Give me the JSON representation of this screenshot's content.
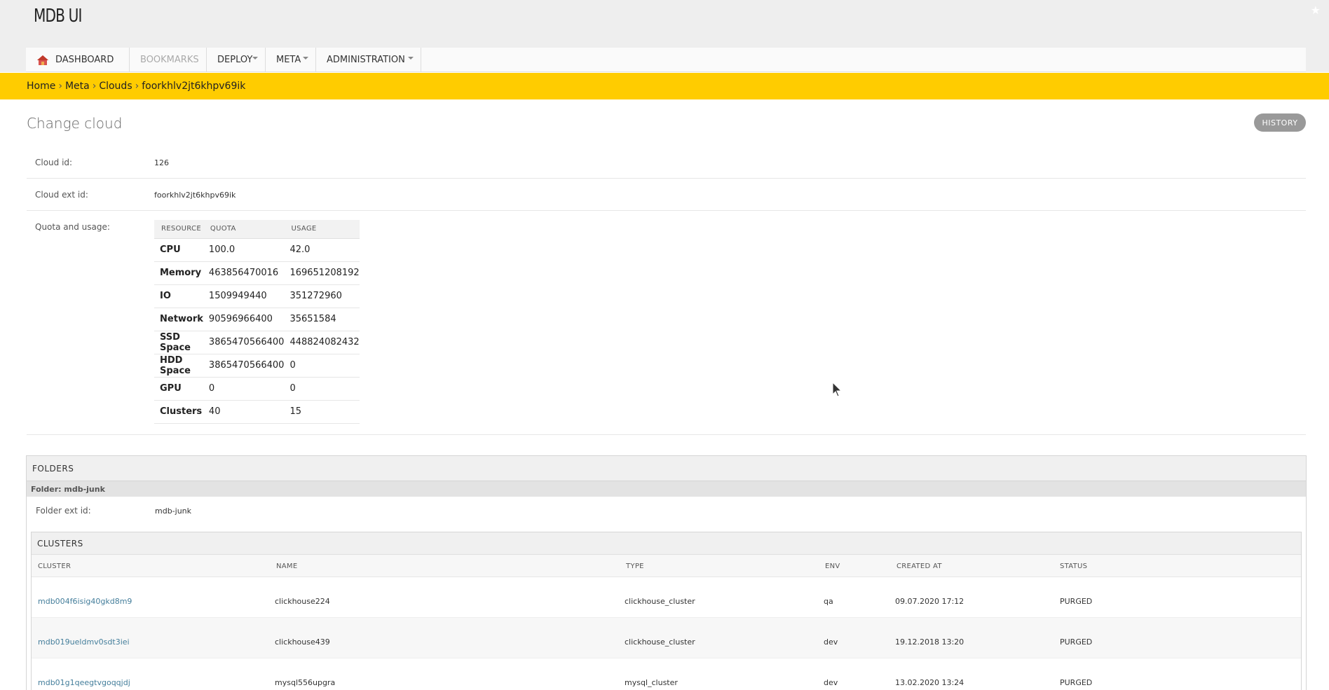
{
  "header": {
    "title": "MDB UI"
  },
  "nav": [
    {
      "label": "Dashboard",
      "state": "active"
    },
    {
      "label": "Bookmarks",
      "state": "disabled"
    },
    {
      "label": "Deploy",
      "dropdown": true
    },
    {
      "label": "Meta",
      "dropdown": true
    },
    {
      "label": "Administration",
      "dropdown": true
    }
  ],
  "breadcrumbs": [
    "Home",
    "Meta",
    "Clouds",
    "foorkhlv2jt6khpv69ik"
  ],
  "breadcrumb_separator": "›",
  "page": {
    "title": "Change cloud",
    "history_label": "History"
  },
  "fields": {
    "cloud_id_label": "Cloud id:",
    "cloud_id_value": "126",
    "cloud_ext_id_label": "Cloud ext id:",
    "cloud_ext_id_value": "foorkhlv2jt6khpv69ik",
    "quota_label": "Quota and usage:"
  },
  "quota": {
    "columns": [
      "Resource",
      "Quota",
      "Usage"
    ],
    "rows": [
      {
        "resource": "CPU",
        "quota": "100.0",
        "usage": "42.0"
      },
      {
        "resource": "Memory",
        "quota": "463856470016",
        "usage": "169651208192"
      },
      {
        "resource": "IO",
        "quota": "1509949440",
        "usage": "351272960"
      },
      {
        "resource": "Network",
        "quota": "90596966400",
        "usage": "35651584"
      },
      {
        "resource": "SSD Space",
        "quota": "3865470566400",
        "usage": "448824082432"
      },
      {
        "resource": "HDD Space",
        "quota": "3865470566400",
        "usage": "0"
      },
      {
        "resource": "GPU",
        "quota": "0",
        "usage": "0"
      },
      {
        "resource": "Clusters",
        "quota": "40",
        "usage": "15"
      }
    ]
  },
  "folders": {
    "title": "Folders",
    "folder_name": "Folder: mdb-junk",
    "ext_id_label": "Folder ext id:",
    "ext_id_value": "mdb-junk",
    "clusters": {
      "title": "Clusters",
      "columns": [
        "Cluster",
        "Name",
        "Type",
        "Env",
        "Created at",
        "Status"
      ],
      "rows": [
        {
          "cluster": "mdb004f6isig40gkd8m9",
          "name": "clickhouse224",
          "type": "clickhouse_cluster",
          "env": "qa",
          "created": "09.07.2020 17:12",
          "status": "PURGED"
        },
        {
          "cluster": "mdb019ueldmv0sdt3iei",
          "name": "clickhouse439",
          "type": "clickhouse_cluster",
          "env": "dev",
          "created": "19.12.2018 13:20",
          "status": "PURGED"
        },
        {
          "cluster": "mdb01g1qeegtvgoqqjdj",
          "name": "mysql556upgra",
          "type": "mysql_cluster",
          "env": "dev",
          "created": "13.02.2020 13:24",
          "status": "PURGED"
        }
      ]
    }
  },
  "colors": {
    "breadcrumb_bg": "#ffcc00",
    "header_bg": "#eeeeee",
    "link": "#447e9b",
    "history_btn": "#999999"
  }
}
